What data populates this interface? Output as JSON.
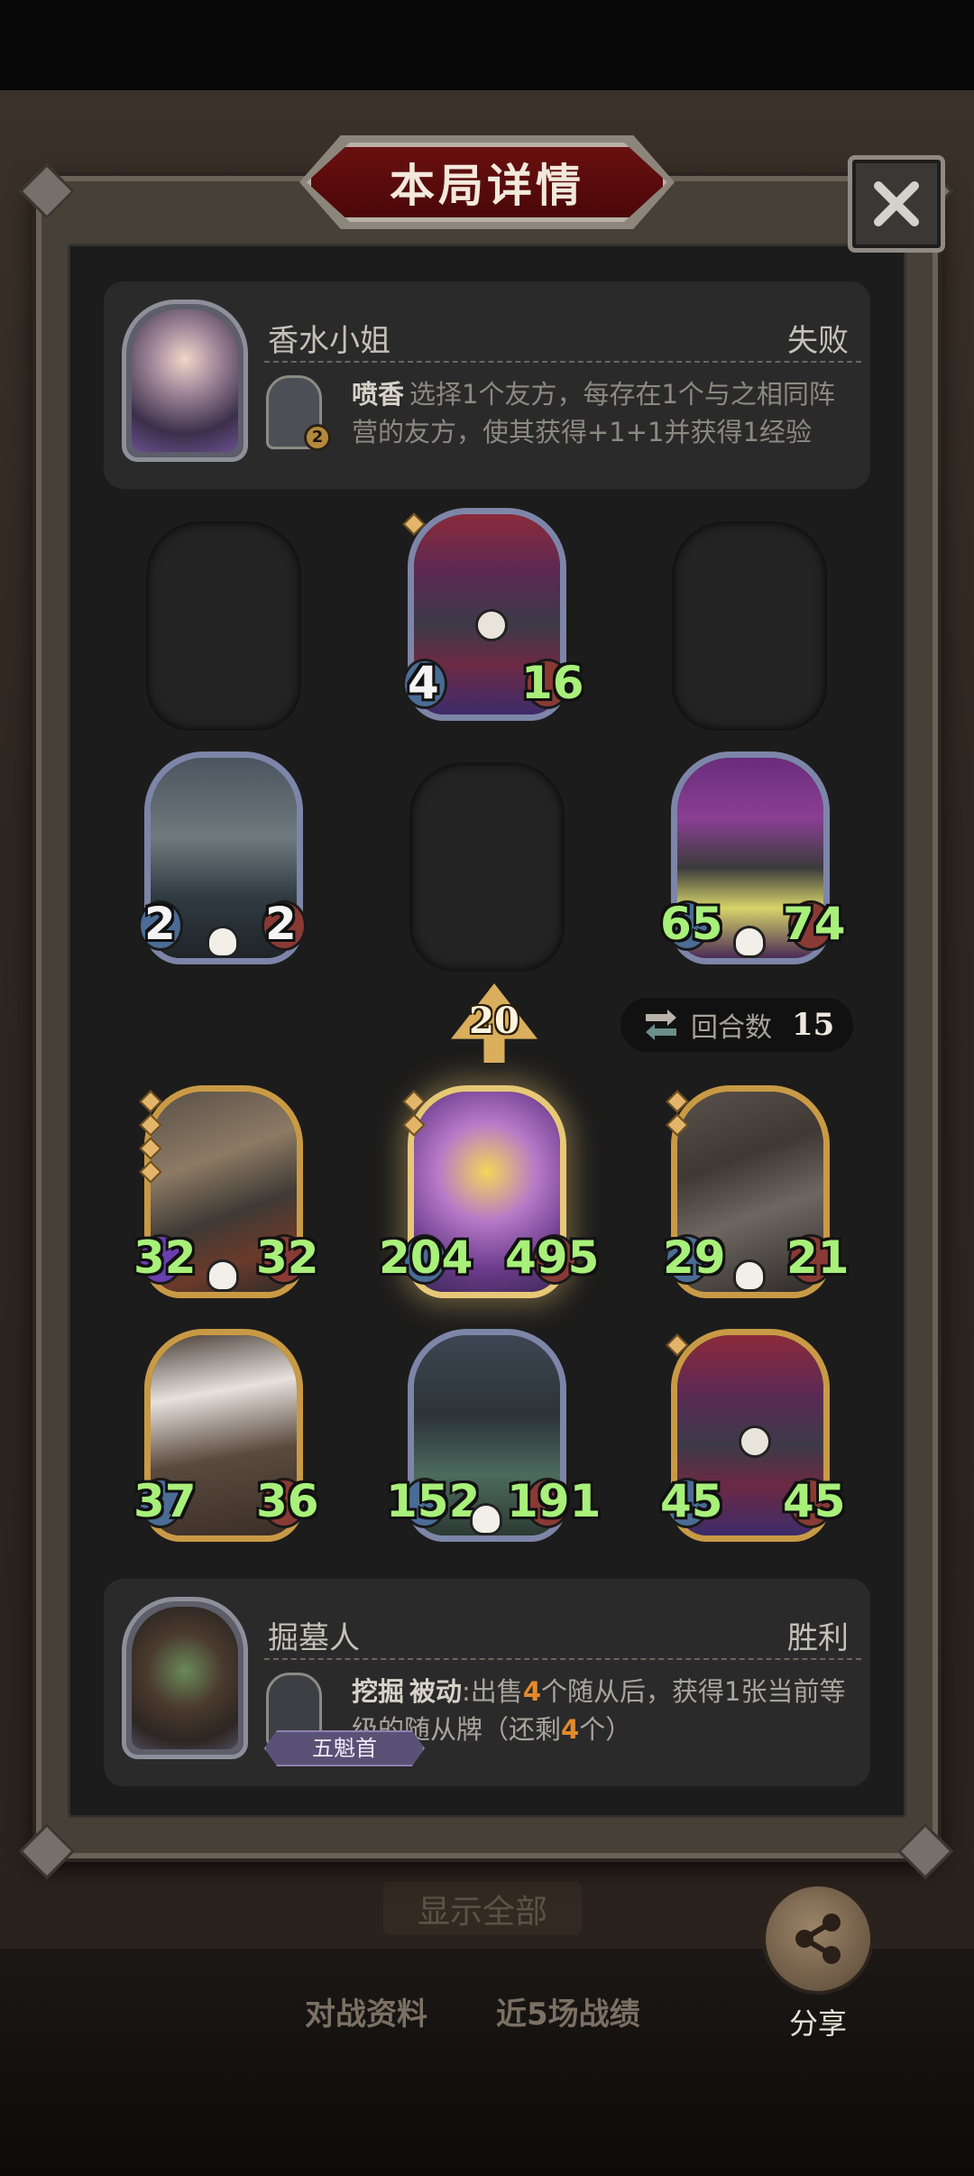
{
  "title": "本局详情",
  "top_player": {
    "name": "香水小姐",
    "result": "失败",
    "power_level": "2",
    "power_name": "喷香",
    "power_desc": "选择1个友方，每存在1个与之相同阵营的友方，使其获得+1+1并获得1经验"
  },
  "opponent_board": [
    {
      "attack": "4",
      "health": "16"
    },
    {
      "attack": "2",
      "health": "2"
    },
    {
      "attack": "65",
      "health": "74"
    }
  ],
  "tavern_level": "20",
  "turns": {
    "label": "回合数",
    "value": "15"
  },
  "my_board": [
    {
      "attack": "32",
      "health": "32"
    },
    {
      "attack": "204",
      "health": "495"
    },
    {
      "attack": "29",
      "health": "21"
    },
    {
      "attack": "37",
      "health": "36"
    },
    {
      "attack": "152",
      "health": "191"
    },
    {
      "attack": "45",
      "health": "45"
    }
  ],
  "bottom_player": {
    "name": "掘墓人",
    "result": "胜利",
    "power_name": "挖掘",
    "power_tag": "被动",
    "power_desc_a": ":出售",
    "power_desc_num": "4",
    "power_desc_b": "个随从后，获得1张当前等级的随从牌（还剩",
    "power_desc_left": "4",
    "power_desc_c": "个）",
    "rank": "五魁首"
  },
  "behind": {
    "show_all": "显示全部",
    "tab1": "对战资料",
    "tab2": "近5场战绩",
    "share": "分享"
  },
  "colors": {
    "accent_green": "#a8f07a",
    "highlight_orange": "#e48a2a",
    "banner_red": "#6a1010"
  }
}
